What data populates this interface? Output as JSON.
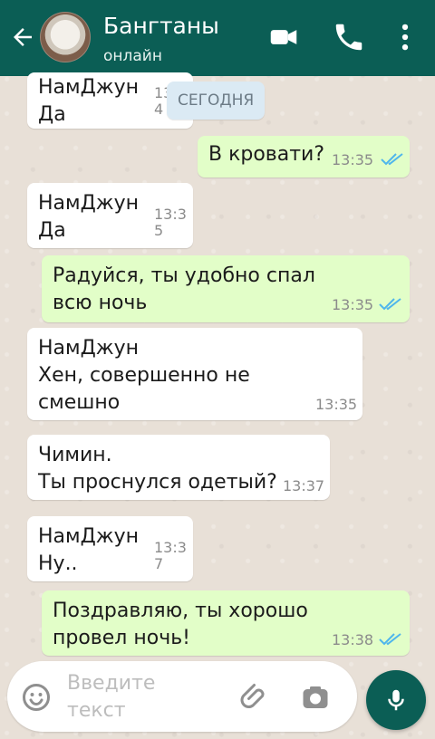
{
  "header": {
    "title": "Бангтаны",
    "status": "онлайн"
  },
  "day_separator": "СЕГОДНЯ",
  "messages": [
    {
      "dir": "in",
      "text": "НамДжун\nДа",
      "time": "13:3\n4"
    },
    {
      "dir": "out",
      "text": "В кровати?",
      "time": "13:35",
      "ticks": "read"
    },
    {
      "dir": "in",
      "text": "НамДжун\nДа",
      "time": "13:3\n5"
    },
    {
      "dir": "out",
      "text": "Радуйся, ты удобно спал\nвсю ночь",
      "time": "13:35",
      "ticks": "read"
    },
    {
      "dir": "in",
      "text": "НамДжун\nХен, совершенно не\nсмешно",
      "time": "13:35"
    },
    {
      "dir": "in",
      "text": "Чимин.\nТы проснулся одетый?",
      "time": "13:37"
    },
    {
      "dir": "in",
      "text": "НамДжун\nНу..",
      "time": "13:3\n7"
    },
    {
      "dir": "out",
      "text": "Поздравляю, ты хорошо\nпровел ночь!",
      "time": "13:38",
      "ticks": "read"
    }
  ],
  "composer": {
    "placeholder": "Введите\nтекст"
  },
  "colors": {
    "header": "#0b5e55",
    "outgoing_bubble": "#e2fec8",
    "incoming_bubble": "#ffffff",
    "read_ticks": "#4fb6ec"
  }
}
